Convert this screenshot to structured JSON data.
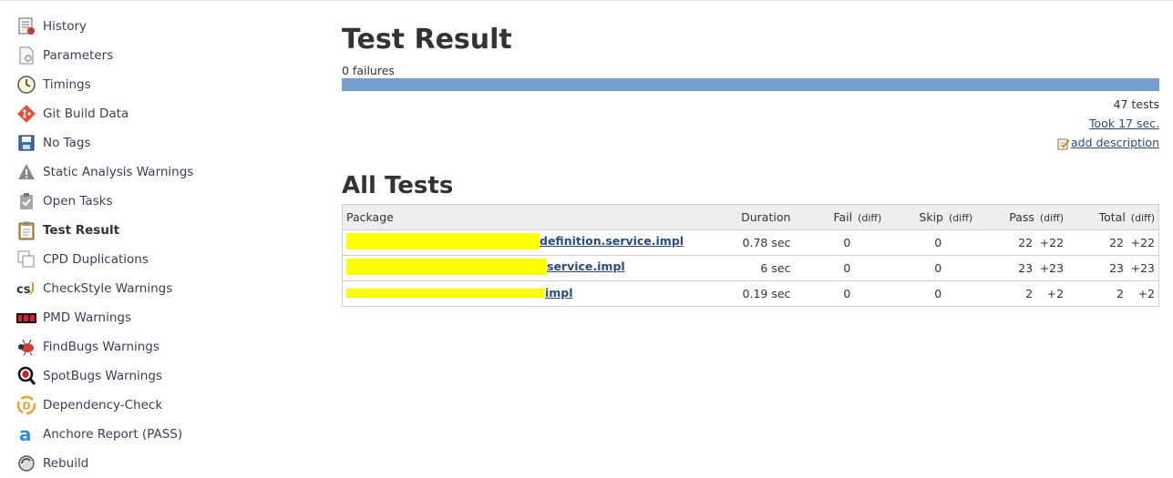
{
  "sidebar": {
    "items": [
      {
        "label": "History",
        "icon": "notepad-icon"
      },
      {
        "label": "Parameters",
        "icon": "parameters-icon"
      },
      {
        "label": "Timings",
        "icon": "clock-icon"
      },
      {
        "label": "Git Build Data",
        "icon": "git-icon"
      },
      {
        "label": "No Tags",
        "icon": "save-icon"
      },
      {
        "label": "Static Analysis Warnings",
        "icon": "warning-icon"
      },
      {
        "label": "Open Tasks",
        "icon": "clipboard-check-icon"
      },
      {
        "label": "Test Result",
        "icon": "clipboard-icon",
        "active": true
      },
      {
        "label": "CPD Duplications",
        "icon": "copy-icon"
      },
      {
        "label": "CheckStyle Warnings",
        "icon": "checkstyle-icon"
      },
      {
        "label": "PMD Warnings",
        "icon": "pmd-icon"
      },
      {
        "label": "FindBugs Warnings",
        "icon": "bug-icon"
      },
      {
        "label": "SpotBugs Warnings",
        "icon": "spotbugs-icon"
      },
      {
        "label": "Dependency-Check",
        "icon": "dependency-check-icon"
      },
      {
        "label": "Anchore Report (PASS)",
        "icon": "anchore-icon"
      },
      {
        "label": "Rebuild",
        "icon": "rebuild-icon"
      }
    ]
  },
  "main": {
    "title": "Test Result",
    "failures": "0 failures",
    "tests_count": "47 tests",
    "took": "Took 17 sec.",
    "add_description": "add description",
    "pass_fraction": 1.0,
    "all_tests_title": "All Tests"
  },
  "table": {
    "headers": {
      "package": "Package",
      "duration": "Duration",
      "fail": "Fail",
      "skip": "Skip",
      "pass": "Pass",
      "total": "Total",
      "diff": "(diff)"
    },
    "rows": [
      {
        "package_visible": "definition.service.impl",
        "duration": "0.78 sec",
        "fail": "0",
        "fail_diff": "",
        "skip": "0",
        "skip_diff": "",
        "pass": "22",
        "pass_diff": "+22",
        "total": "22",
        "total_diff": "+22"
      },
      {
        "package_visible": "service.impl",
        "duration": "6 sec",
        "fail": "0",
        "fail_diff": "",
        "skip": "0",
        "skip_diff": "",
        "pass": "23",
        "pass_diff": "+23",
        "total": "23",
        "total_diff": "+23"
      },
      {
        "package_visible": "impl",
        "duration": "0.19 sec",
        "fail": "0",
        "fail_diff": "",
        "skip": "0",
        "skip_diff": "",
        "pass": "2",
        "pass_diff": "+2",
        "total": "2",
        "total_diff": "+2"
      }
    ]
  },
  "colors": {
    "progress_bar": "#729fcf",
    "link": "#2b4c7e",
    "redaction": "#ffff00"
  }
}
